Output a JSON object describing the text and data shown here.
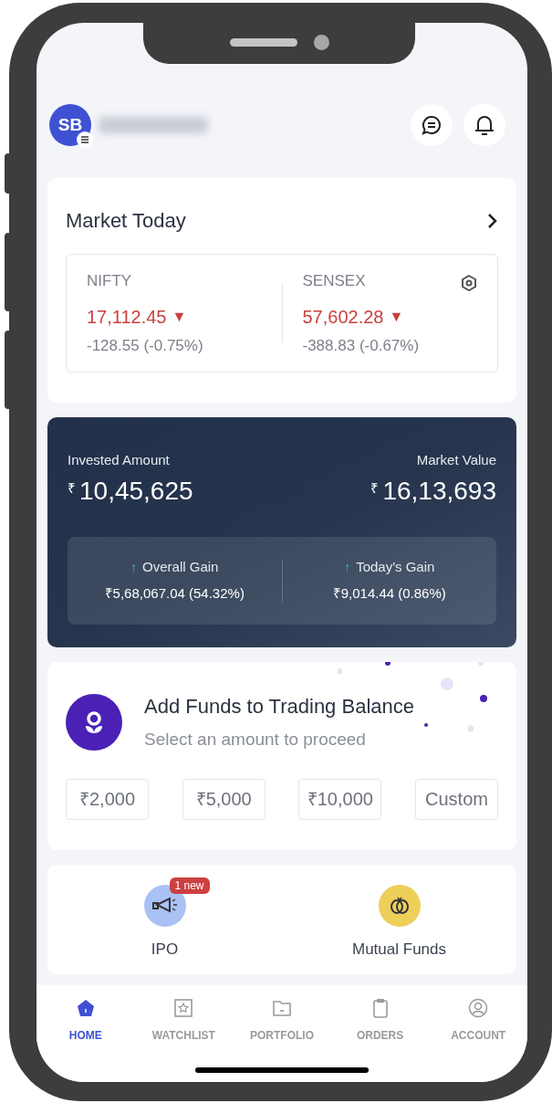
{
  "header": {
    "avatar_initials": "SB"
  },
  "market_today": {
    "title": "Market Today",
    "indices": [
      {
        "name": "NIFTY",
        "value": "17,112.45",
        "arrow": "▼",
        "change": "-128.55 (-0.75%)"
      },
      {
        "name": "SENSEX",
        "value": "57,602.28",
        "arrow": "▼",
        "change": "-388.83 (-0.67%)"
      }
    ]
  },
  "portfolio": {
    "invested_label": "Invested Amount",
    "invested_currency": "₹",
    "invested_value": "10,45,625",
    "market_label": "Market Value",
    "market_currency": "₹",
    "market_value": "16,13,693",
    "gains": [
      {
        "label": "Overall Gain",
        "arrow": "↑",
        "value": "₹5,68,067.04 (54.32%)"
      },
      {
        "label": "Today's Gain",
        "arrow": "↑",
        "value": "₹9,014.44 (0.86%)"
      }
    ]
  },
  "add_funds": {
    "title": "Add Funds to Trading Balance",
    "subtitle": "Select an amount to proceed",
    "amounts": [
      "₹2,000",
      "₹5,000",
      "₹10,000",
      "Custom"
    ]
  },
  "shortcuts": [
    {
      "label": "IPO",
      "kind": "ipo",
      "badge": "1 new"
    },
    {
      "label": "Mutual Funds",
      "kind": "funds"
    }
  ],
  "bottom_nav": [
    {
      "label": "HOME",
      "kind": "home",
      "selected": true
    },
    {
      "label": "WATCHLIST",
      "kind": "watchlist",
      "selected": false
    },
    {
      "label": "PORTFOLIO",
      "kind": "portfolio",
      "selected": false
    },
    {
      "label": "ORDERS",
      "kind": "orders",
      "selected": false
    },
    {
      "label": "ACCOUNT",
      "kind": "account",
      "selected": false
    }
  ]
}
